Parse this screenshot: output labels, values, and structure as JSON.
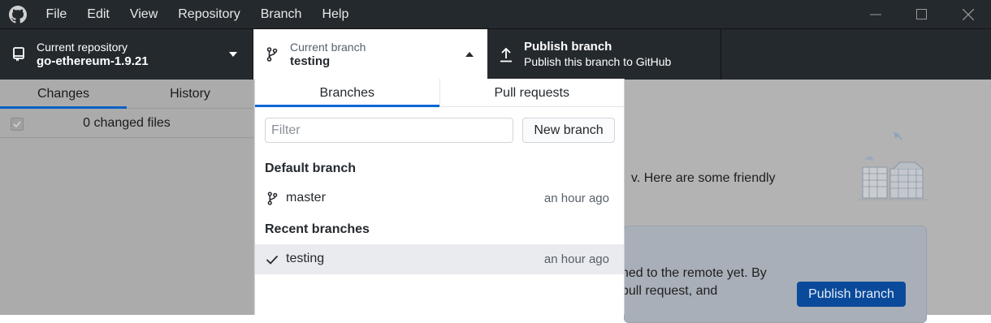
{
  "menu": [
    "File",
    "Edit",
    "View",
    "Repository",
    "Branch",
    "Help"
  ],
  "toolbar": {
    "repo": {
      "sub": "Current repository",
      "main": "go-ethereum-1.9.21"
    },
    "branch": {
      "sub": "Current branch",
      "main": "testing"
    },
    "publish": {
      "main": "Publish branch",
      "sub": "Publish this branch to GitHub"
    }
  },
  "left": {
    "tabs": [
      "Changes",
      "History"
    ],
    "changed_files": "0 changed files"
  },
  "main": {
    "friendly_text": "v. Here are some friendly",
    "card_line1": "hed to the remote yet. By",
    "card_line2": "pull request, and",
    "card_button": "Publish branch"
  },
  "dropdown": {
    "tabs": [
      "Branches",
      "Pull requests"
    ],
    "filter_placeholder": "Filter",
    "new_branch": "New branch",
    "default_header": "Default branch",
    "default_branches": [
      {
        "name": "master",
        "time": "an hour ago"
      }
    ],
    "recent_header": "Recent branches",
    "recent_branches": [
      {
        "name": "testing",
        "time": "an hour ago",
        "selected": true
      }
    ]
  },
  "colors": {
    "titlebar": "#24292e",
    "accent": "#0366d6",
    "selected_row": "#e9ebee",
    "dim_overlay": "#b3b3b3"
  }
}
